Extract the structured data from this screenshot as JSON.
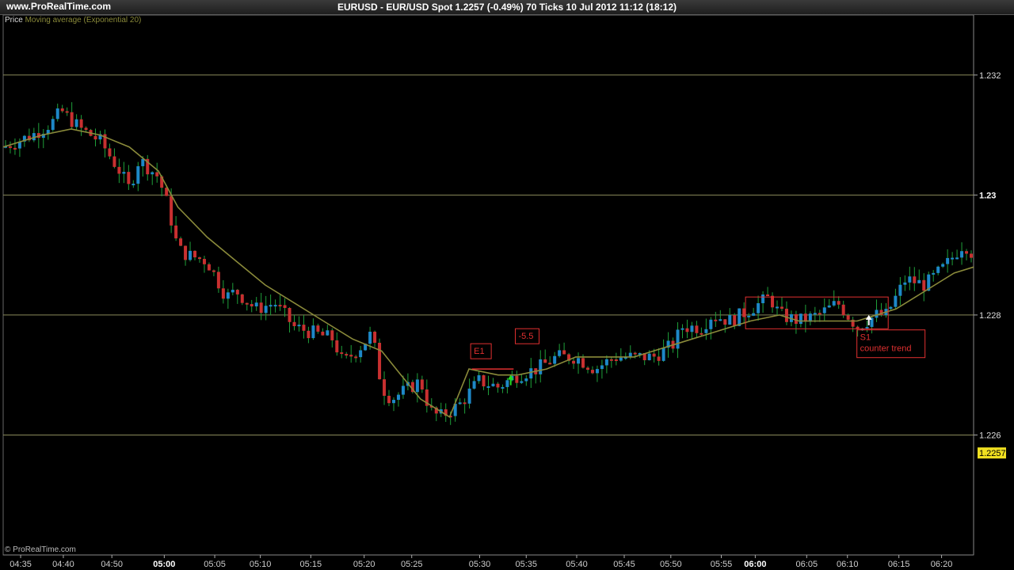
{
  "header": {
    "site": "www.ProRealTime.com",
    "title": "EURUSD - EUR/USD Spot    1.2257 (-0.49%)    70 Ticks  10 Jul 2012 11:12 (18:12)"
  },
  "legend": {
    "price": "Price",
    "ma": "Moving average (Exponential 20)"
  },
  "footer": "© ProRealTime.com",
  "colors": {
    "up": "#1e88c8",
    "down": "#c83030",
    "wick": "#1fa03a",
    "ma": "#8a8a3a",
    "grid": "#8a8a5a",
    "annotation": "#e03030"
  },
  "chart_data": {
    "type": "candlestick",
    "instrument": "EURUSD - EUR/USD Spot",
    "last_price": "1.2257",
    "y_range": [
      1.224,
      1.233
    ],
    "x_range": [
      0,
      100
    ],
    "y_ticks": [
      {
        "value": 1.232,
        "label": "1.232",
        "major": false
      },
      {
        "value": 1.23,
        "label": "1.23",
        "major": true
      },
      {
        "value": 1.228,
        "label": "1.228",
        "major": false
      },
      {
        "value": 1.226,
        "label": "1.226",
        "major": false
      }
    ],
    "x_ticks": [
      {
        "x": 1.8,
        "label": "04:35",
        "major": false
      },
      {
        "x": 6.2,
        "label": "04:40",
        "major": false
      },
      {
        "x": 11.2,
        "label": "04:50",
        "major": false
      },
      {
        "x": 16.6,
        "label": "05:00",
        "major": true
      },
      {
        "x": 21.8,
        "label": "05:05",
        "major": false
      },
      {
        "x": 26.5,
        "label": "05:10",
        "major": false
      },
      {
        "x": 31.7,
        "label": "05:15",
        "major": false
      },
      {
        "x": 37.2,
        "label": "05:20",
        "major": false
      },
      {
        "x": 42.1,
        "label": "05:25",
        "major": false
      },
      {
        "x": 49.1,
        "label": "05:30",
        "major": false
      },
      {
        "x": 53.9,
        "label": "05:35",
        "major": false
      },
      {
        "x": 59.1,
        "label": "05:40",
        "major": false
      },
      {
        "x": 64.0,
        "label": "05:45",
        "major": false
      },
      {
        "x": 68.8,
        "label": "05:50",
        "major": false
      },
      {
        "x": 74.0,
        "label": "05:55",
        "major": false
      },
      {
        "x": 77.5,
        "label": "06:00",
        "major": true
      },
      {
        "x": 82.8,
        "label": "06:05",
        "major": false
      },
      {
        "x": 87.0,
        "label": "06:10",
        "major": false
      },
      {
        "x": 92.3,
        "label": "06:15",
        "major": false
      },
      {
        "x": 96.7,
        "label": "06:20",
        "major": false
      }
    ],
    "price_path": [
      [
        0,
        1.2308
      ],
      [
        3,
        1.231
      ],
      [
        5,
        1.2312
      ],
      [
        6,
        1.2314
      ],
      [
        8,
        1.2311
      ],
      [
        10,
        1.2309
      ],
      [
        12,
        1.2304
      ],
      [
        13,
        1.2301
      ],
      [
        14,
        1.2306
      ],
      [
        16,
        1.2303
      ],
      [
        17,
        1.2298
      ],
      [
        18,
        1.2291
      ],
      [
        19,
        1.229
      ],
      [
        21,
        1.2289
      ],
      [
        23,
        1.2283
      ],
      [
        24,
        1.2284
      ],
      [
        26,
        1.2281
      ],
      [
        28,
        1.2282
      ],
      [
        30,
        1.2278
      ],
      [
        32,
        1.2277
      ],
      [
        34,
        1.2276
      ],
      [
        35,
        1.2272
      ],
      [
        37,
        1.2275
      ],
      [
        38,
        1.2277
      ],
      [
        39,
        1.2268
      ],
      [
        40,
        1.2266
      ],
      [
        42,
        1.2268
      ],
      [
        43,
        1.2269
      ],
      [
        44,
        1.2264
      ],
      [
        45,
        1.2263
      ],
      [
        47,
        1.2265
      ],
      [
        49,
        1.2269
      ],
      [
        51,
        1.2268
      ],
      [
        53,
        1.227
      ],
      [
        55,
        1.2271
      ],
      [
        57,
        1.2273
      ],
      [
        59,
        1.2273
      ],
      [
        61,
        1.2271
      ],
      [
        63,
        1.2273
      ],
      [
        65,
        1.2273
      ],
      [
        67,
        1.2273
      ],
      [
        69,
        1.2275
      ],
      [
        70,
        1.2278
      ],
      [
        72,
        1.2278
      ],
      [
        73,
        1.228
      ],
      [
        75,
        1.2279
      ],
      [
        77,
        1.2281
      ],
      [
        79,
        1.2283
      ],
      [
        80,
        1.228
      ],
      [
        82,
        1.2279
      ],
      [
        84,
        1.228
      ],
      [
        86,
        1.2282
      ],
      [
        88,
        1.2278
      ],
      [
        90,
        1.228
      ],
      [
        91,
        1.228
      ],
      [
        93,
        1.2286
      ],
      [
        95,
        1.2285
      ],
      [
        97,
        1.2288
      ],
      [
        99,
        1.2292
      ],
      [
        100,
        1.229
      ]
    ],
    "ma_path": [
      [
        0,
        1.2308
      ],
      [
        4,
        1.231
      ],
      [
        7,
        1.2311
      ],
      [
        10,
        1.231
      ],
      [
        13,
        1.2308
      ],
      [
        16,
        1.2304
      ],
      [
        18,
        1.2298
      ],
      [
        21,
        1.2293
      ],
      [
        24,
        1.2289
      ],
      [
        27,
        1.2285
      ],
      [
        30,
        1.2282
      ],
      [
        33,
        1.2279
      ],
      [
        36,
        1.2276
      ],
      [
        39,
        1.2274
      ],
      [
        41,
        1.227
      ],
      [
        43,
        1.2266
      ],
      [
        46,
        1.2263
      ],
      [
        48,
        1.2271
      ],
      [
        51,
        1.227
      ],
      [
        53,
        1.227
      ],
      [
        56,
        1.2271
      ],
      [
        59,
        1.2273
      ],
      [
        62,
        1.2273
      ],
      [
        65,
        1.2273
      ],
      [
        67,
        1.2274
      ],
      [
        69,
        1.2275
      ],
      [
        71,
        1.2276
      ],
      [
        73,
        1.2277
      ],
      [
        75,
        1.2278
      ],
      [
        77,
        1.2279
      ],
      [
        80,
        1.228
      ],
      [
        82,
        1.2279
      ],
      [
        85,
        1.2279
      ],
      [
        88,
        1.2279
      ],
      [
        90,
        1.228
      ],
      [
        92,
        1.2281
      ],
      [
        94,
        1.2283
      ],
      [
        96,
        1.2285
      ],
      [
        98,
        1.2287
      ],
      [
        100,
        1.2288
      ]
    ],
    "annotations": [
      {
        "label": "E1",
        "x": 48.5,
        "y": 1.22735
      },
      {
        "label": "-5.5",
        "x": 53.1,
        "y": 1.2276
      },
      {
        "label": "S1",
        "x": 88.3,
        "y": 1.22758
      },
      {
        "label": "counter trend",
        "x": 88.3,
        "y": 1.2274
      }
    ],
    "rectangle": {
      "x0": 76.5,
      "x1": 91.2,
      "y0": 1.2283,
      "y1": 1.22777
    },
    "entry_arrow": {
      "x": 52.3,
      "y": 1.227
    },
    "exit_arrow": {
      "x": 89.2,
      "y": 1.228
    }
  }
}
